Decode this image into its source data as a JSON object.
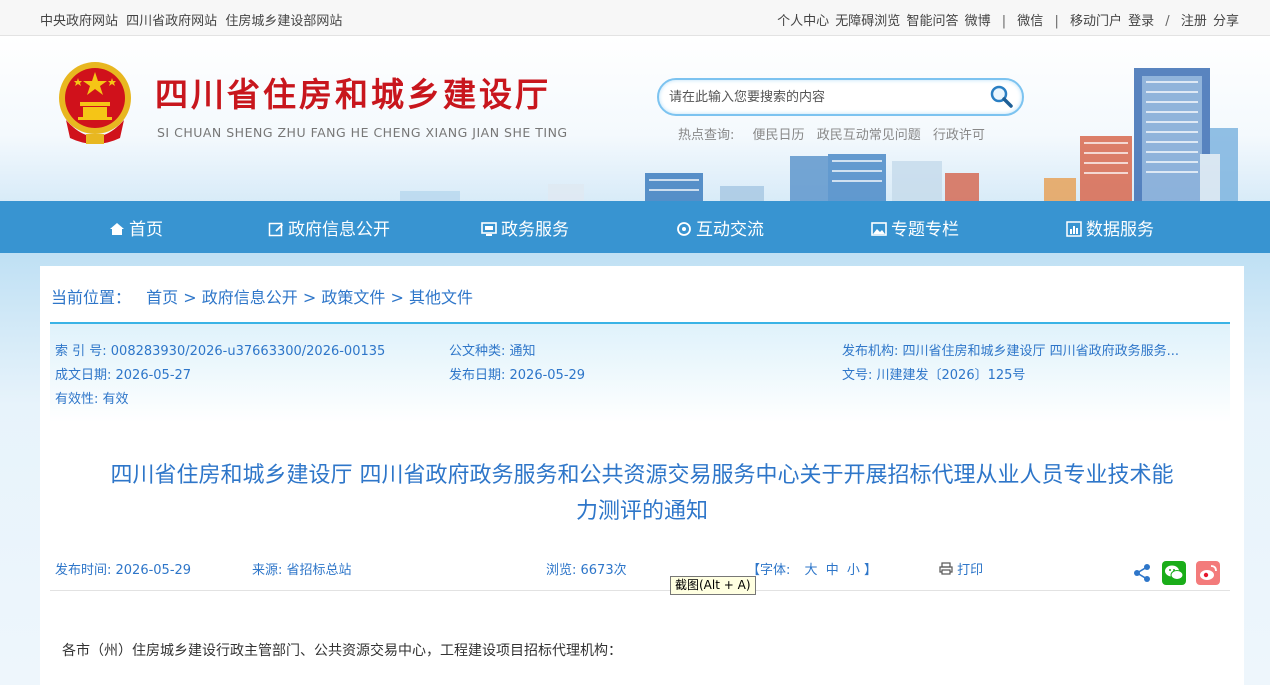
{
  "topbar": {
    "left_links": [
      "中央政府网站",
      "四川省政府网站",
      "住房城乡建设部网站"
    ],
    "right_links": [
      "个人中心",
      "无障碍浏览",
      "智能问答",
      "微博",
      "微信",
      "移动门户",
      "登录",
      "注册",
      "分享"
    ]
  },
  "header": {
    "title": "四川省住房和城乡建设厅",
    "subtitle": "SI CHUAN SHENG ZHU FANG HE CHENG XIANG JIAN SHE TING",
    "search_placeholder": "请在此输入您要搜索的内容",
    "hot_label": "热点查询:",
    "hot_links": [
      "便民日历",
      "政民互动常见问题",
      "行政许可"
    ]
  },
  "nav": {
    "items": [
      {
        "label": "首页",
        "icon": "home-icon"
      },
      {
        "label": "政府信息公开",
        "icon": "edit-icon"
      },
      {
        "label": "政务服务",
        "icon": "monitor-icon"
      },
      {
        "label": "互动交流",
        "icon": "exchange-icon"
      },
      {
        "label": "专题专栏",
        "icon": "image-icon"
      },
      {
        "label": "数据服务",
        "icon": "chart-icon"
      }
    ]
  },
  "breadcrumb": {
    "label": "当前位置：",
    "items": [
      "首页",
      "政府信息公开",
      "政策文件",
      "其他文件"
    ],
    "separator": ">"
  },
  "meta": {
    "index_no": "索 引 号:  008283930/2026-u37663300/2026-00135",
    "doc_type": "公文种类:  通知",
    "publisher": "发布机构:  四川省住房和城乡建设厅 四川省政府政务服务...",
    "created": "成文日期:  2026-05-27",
    "published": "发布日期:  2026-05-29",
    "doc_no": "文号:  川建建发〔2026〕125号",
    "validity": "有效性:  有效"
  },
  "article": {
    "title_line1": "四川省住房和城乡建设厅 四川省政府政务服务和公共资源交易服务中心关于开展招标代理从业人员专业技术能",
    "title_line2": "力测评的通知",
    "publish_time": "发布时间:  2026-05-29",
    "source": "来源:  省招标总站",
    "views": "浏览:  6673次",
    "font_label": "【字体:",
    "font_sizes": [
      "大",
      "中",
      "小"
    ],
    "font_close": "】",
    "print_label": "打印",
    "first_line": "各市（州）住房城乡建设行政主管部门、公共资源交易中心，工程建设项目招标代理机构："
  },
  "tooltip": "截图(Alt + A)",
  "colors": {
    "title_red": "#c8161d",
    "nav_blue": "#288ccd",
    "link_blue": "#2e76c9",
    "wechat_green": "#1aad19",
    "weibo_red": "#e6162d"
  }
}
